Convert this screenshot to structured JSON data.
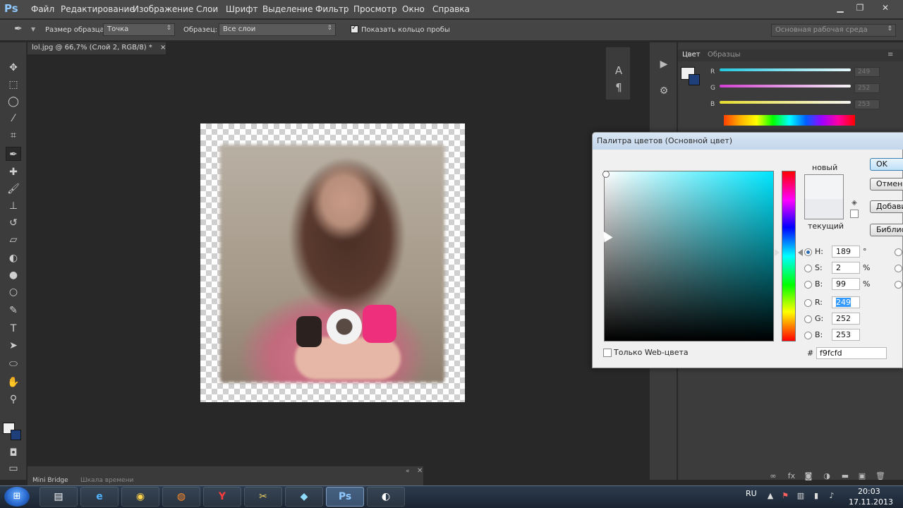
{
  "app": {
    "logo": "Ps",
    "menu": [
      "Файл",
      "Редактирование",
      "Изображение",
      "Слои",
      "Шрифт",
      "Выделение",
      "Фильтр",
      "Просмотр",
      "Окно",
      "Справка"
    ],
    "window_controls": [
      "minimize-icon",
      "restore-icon",
      "close-icon"
    ]
  },
  "options_bar": {
    "sample_size_label": "Размер образца:",
    "sample_size_value": "Точка",
    "sample_label": "Образец:",
    "sample_value": "Все слои",
    "show_ring_label": "Показать кольцо пробы",
    "show_ring_checked": true,
    "workspace": "Основная рабочая среда"
  },
  "document": {
    "tab_title": "lol.jpg @ 66,7% (Слой 2, RGB/8) *",
    "tab_close": "×"
  },
  "tools": [
    "move-icon",
    "marquee-icon",
    "lasso-icon",
    "quick-select-icon",
    "crop-icon",
    "eyedropper-icon",
    "healing-icon",
    "brush-icon",
    "stamp-icon",
    "history-brush-icon",
    "eraser-icon",
    "bucket-icon",
    "blur-icon",
    "dodge-icon",
    "pen-icon",
    "type-icon",
    "path-select-icon",
    "shape-icon",
    "hand-icon",
    "zoom-icon"
  ],
  "color_panel": {
    "tabs": [
      "Цвет",
      "Образцы"
    ],
    "sliders": [
      {
        "label": "R",
        "value": "249",
        "color": "#2fd2e6"
      },
      {
        "label": "G",
        "value": "252",
        "color": "#d23fd2"
      },
      {
        "label": "B",
        "value": "253",
        "color": "#e6dc2f"
      }
    ],
    "foreground": "#f0f0f0",
    "background": "#1e3f7a"
  },
  "bottom_panel": {
    "tabs": [
      "Mini Bridge",
      "Шкала времени"
    ]
  },
  "dialog": {
    "title": "Палитра цветов (Основной цвет)",
    "new_label": "новый",
    "current_label": "текущий",
    "new_color": "#f9fcfd",
    "buttons": [
      "OK",
      "Отмена",
      "Добавить в образцы",
      "Библиотеки цветов"
    ],
    "fields": [
      {
        "label": "H:",
        "value": "189",
        "unit": "°",
        "selected": true
      },
      {
        "label": "S:",
        "value": "2",
        "unit": "%"
      },
      {
        "label": "B:",
        "value": "99",
        "unit": "%"
      },
      {
        "label": "R:",
        "value": "249",
        "unit": ""
      },
      {
        "label": "G:",
        "value": "252",
        "unit": ""
      },
      {
        "label": "B:",
        "value": "253",
        "unit": ""
      }
    ],
    "hex_label": "#",
    "hex_value": "f9fcfd",
    "web_only_label": "Только Web-цвета"
  },
  "taskbar": {
    "apps": [
      {
        "name": "explorer",
        "glyph": "▤"
      },
      {
        "name": "ie",
        "glyph": "e"
      },
      {
        "name": "chrome",
        "glyph": "◉"
      },
      {
        "name": "firefox",
        "glyph": "◍"
      },
      {
        "name": "yandex",
        "glyph": "Y"
      },
      {
        "name": "app6",
        "glyph": "✂"
      },
      {
        "name": "app7",
        "glyph": "◆"
      },
      {
        "name": "photoshop",
        "glyph": "Ps"
      },
      {
        "name": "app9",
        "glyph": "◐"
      }
    ],
    "lang": "RU",
    "time": "20:03",
    "date": "17.11.2013"
  }
}
